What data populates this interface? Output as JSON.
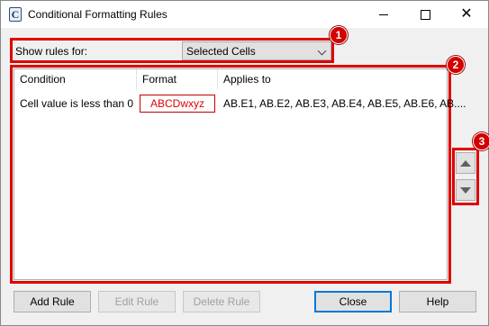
{
  "window": {
    "title": "Conditional Formatting Rules",
    "app_icon_letter": "C",
    "controls": {
      "minimize": "minimize-icon",
      "maximize": "maximize-icon",
      "close": "close-icon",
      "close_glyph": "✕"
    }
  },
  "show_rules": {
    "label": "Show rules for:",
    "selected": "Selected Cells"
  },
  "rules_table": {
    "columns": [
      "Condition",
      "Format",
      "Applies to"
    ],
    "rows": [
      {
        "condition": "Cell value is less than 0",
        "format_preview": "ABCDwxyz",
        "applies_to": "AB.E1, AB.E2, AB.E3, AB.E4, AB.E5, AB.E6, AB...."
      }
    ]
  },
  "move_buttons": {
    "up": "move-up-icon",
    "down": "move-down-icon"
  },
  "annotations": [
    "1",
    "2",
    "3"
  ],
  "buttons": {
    "add_rule": "Add Rule",
    "edit_rule": "Edit Rule",
    "delete_rule": "Delete Rule",
    "close": "Close",
    "help": "Help"
  },
  "colors": {
    "highlight": "#e00000",
    "badge": "#d40000",
    "format_preview_text": "#e00000",
    "default_button_border": "#0078d7"
  }
}
